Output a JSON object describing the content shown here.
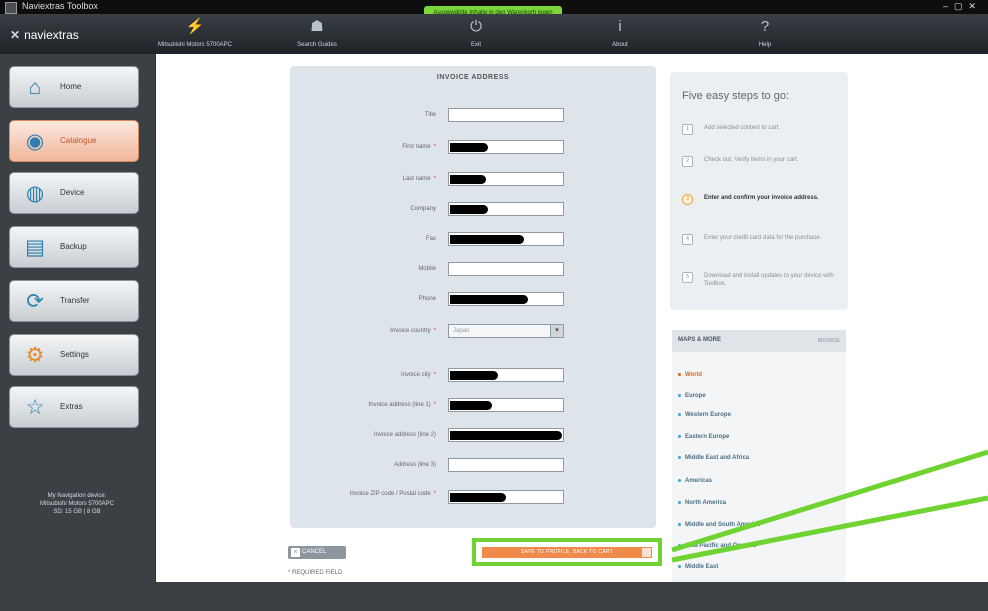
{
  "window": {
    "title": "Naviextras Toolbox"
  },
  "notice": {
    "text": "Ausgewählte Inhalte in den Warenkorb legen"
  },
  "app": {
    "logo": "naviextras"
  },
  "topnav": [
    {
      "label": "Mitsubishi Motors 5700APC",
      "icon": "plug-icon"
    },
    {
      "label": "Search Guides",
      "icon": "people-icon"
    },
    {
      "label": "Exit",
      "icon": "power-icon"
    },
    {
      "label": "About",
      "icon": "info-icon"
    },
    {
      "label": "Help",
      "icon": "help-icon"
    }
  ],
  "sidebar": [
    {
      "label": "Home",
      "icon": "home-icon",
      "active": false
    },
    {
      "label": "Catalogue",
      "icon": "catalogue-icon",
      "active": true
    },
    {
      "label": "Device",
      "icon": "device-icon",
      "active": false
    },
    {
      "label": "Backup",
      "icon": "backup-icon",
      "active": false
    },
    {
      "label": "Transfer",
      "icon": "transfer-icon",
      "active": false
    },
    {
      "label": "Settings",
      "icon": "gear-icon",
      "active": false
    },
    {
      "label": "Extras",
      "icon": "star-icon",
      "active": false
    }
  ],
  "device_info": {
    "line1": "My Navigation device:",
    "line2": "Mitsubishi Motors 5700APC",
    "line3": "SD: 15 GB | 8 GB"
  },
  "form": {
    "title": "INVOICE ADDRESS",
    "fields": [
      {
        "label": "Title",
        "required": false,
        "type": "text",
        "value": ""
      },
      {
        "label": "First name",
        "required": true,
        "type": "text",
        "value": "",
        "redacted": true
      },
      {
        "label": "Last name",
        "required": true,
        "type": "text",
        "value": "",
        "redacted": true
      },
      {
        "label": "Company",
        "required": false,
        "type": "text",
        "value": "",
        "redacted": true
      },
      {
        "label": "Fax",
        "required": false,
        "type": "text",
        "value": "",
        "redacted": true
      },
      {
        "label": "Mobile",
        "required": false,
        "type": "text",
        "value": ""
      },
      {
        "label": "Phone",
        "required": false,
        "type": "text",
        "value": "",
        "redacted": true
      },
      {
        "label": "Invoice country",
        "required": true,
        "type": "select",
        "value": "Japan"
      },
      {
        "label": "Invoice city",
        "required": true,
        "type": "text",
        "value": "",
        "redacted": true
      },
      {
        "label": "Invoice address (line 1)",
        "required": true,
        "type": "text",
        "value": "",
        "redacted": true
      },
      {
        "label": "Invoice address (line 2)",
        "required": false,
        "type": "text",
        "value": "",
        "redacted": true
      },
      {
        "label": "Address (line 3)",
        "required": false,
        "type": "text",
        "value": ""
      },
      {
        "label": "Invoice ZIP code / Postal code",
        "required": true,
        "type": "text",
        "value": "",
        "redacted": true
      }
    ],
    "cancel_label": "CANCEL",
    "save_label": "SAVE TO PROFILE, BACK TO CART",
    "required_note": "* REQUIRED FIELD"
  },
  "steps": {
    "title": "Five easy steps to go:",
    "items": [
      {
        "num": "1",
        "text": "Add selected content to cart.",
        "current": false
      },
      {
        "num": "2",
        "text": "Check out, Verify items in your cart.",
        "current": false
      },
      {
        "num": "3",
        "text": "Enter and confirm your invoice address.",
        "current": true
      },
      {
        "num": "4",
        "text": "Enter your credit card data for the purchase.",
        "current": false
      },
      {
        "num": "5",
        "text": "Download and install updates to your device with Toolbox.",
        "current": false
      }
    ]
  },
  "maps": {
    "title": "MAPS & MORE",
    "browse": "BROWSE",
    "items": [
      {
        "label": "World",
        "selected": true
      },
      {
        "label": "Europe",
        "selected": false
      },
      {
        "label": "Western Europe",
        "selected": false
      },
      {
        "label": "Eastern Europe",
        "selected": false
      },
      {
        "label": "Middle East and Africa",
        "selected": false
      },
      {
        "label": "Americas",
        "selected": false
      },
      {
        "label": "North America",
        "selected": false
      },
      {
        "label": "Middle and South America",
        "selected": false
      },
      {
        "label": "Asia Pacific and Oceania",
        "selected": false
      },
      {
        "label": "Middle East",
        "selected": false
      }
    ]
  },
  "colors": {
    "accent": "#f08a4b",
    "highlight": "#6fd431",
    "active_tab": "#f0b69a"
  }
}
